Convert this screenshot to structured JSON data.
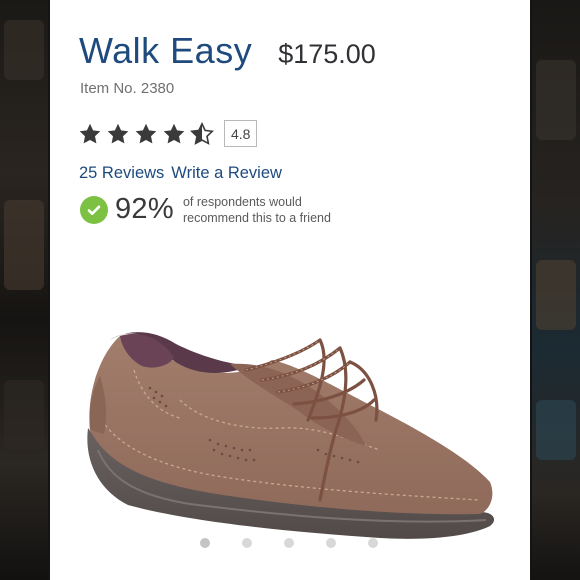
{
  "product": {
    "name": "Walk Easy",
    "price": "$175.00",
    "item_number": "Item No. 2380"
  },
  "rating": {
    "value": 4.8,
    "display": "4.8",
    "stars_max": 5
  },
  "reviews": {
    "count_label": "25 Reviews",
    "write_label": "Write a Review"
  },
  "recommendation": {
    "percent": "92%",
    "text_line1": "of respondents would",
    "text_line2": "recommend this to a friend"
  },
  "carousel": {
    "total": 5,
    "active_index": 0
  },
  "colors": {
    "title": "#1e4a7e",
    "check": "#7cc142",
    "star": "#3a3a3a"
  },
  "icons": [
    "star-icon",
    "star-half-icon",
    "checkmark-icon"
  ]
}
